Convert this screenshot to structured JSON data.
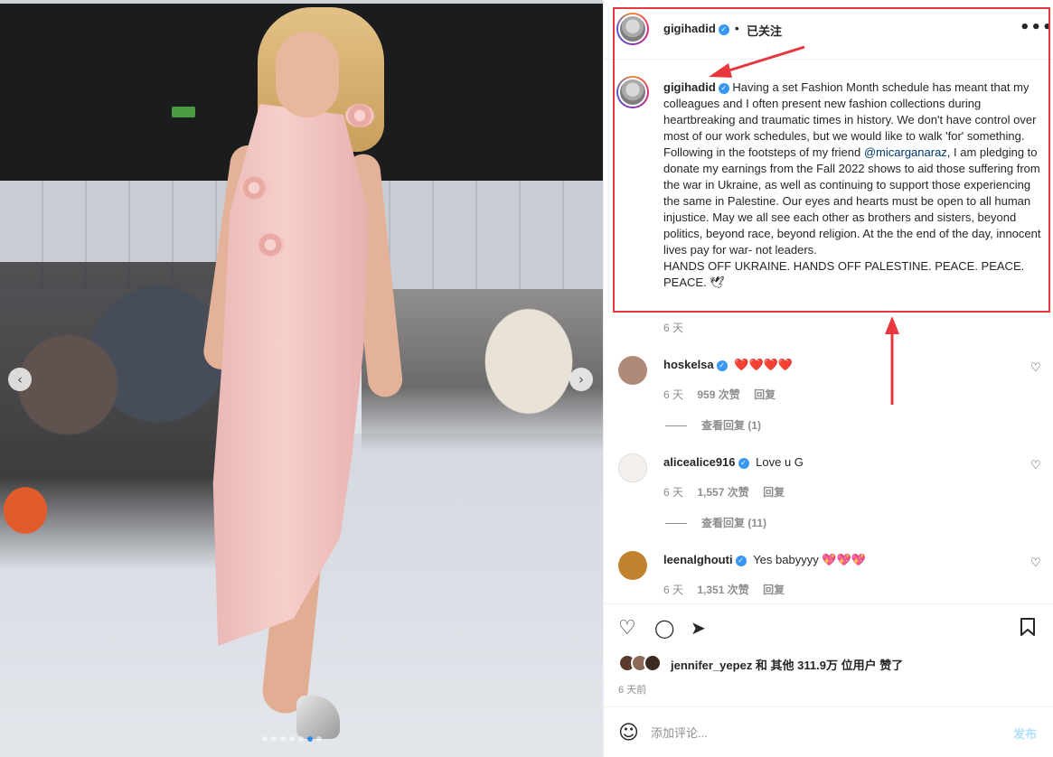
{
  "post": {
    "author": "gigihadid",
    "follow_status": "已关注",
    "dot": "•",
    "more": "•••",
    "caption_prefix": "Having a set Fashion Month schedule has meant that my colleagues and I often present new fashion collections during heartbreaking and traumatic times in history. We don't have control over most of our work schedules, but we would like to walk 'for' something. Following in the footsteps of my friend ",
    "caption_mention": "@micarganaraz",
    "caption_suffix": ", I am pledging to donate my earnings from the Fall 2022 shows to aid those suffering from the war in Ukraine, as well as continuing to support those experiencing the same in Palestine. Our eyes and hearts must be open to all human injustice. May we all see each other as brothers and sisters, beyond politics, beyond race, beyond religion. At the the end of the day, innocent lives pay for war- not leaders.",
    "caption_line2": "HANDS OFF UKRAINE. HANDS OFF PALESTINE. PEACE. PEACE. PEACE. 🕊",
    "caption_time": "6 天",
    "verified_glyph": "✓"
  },
  "comments": [
    {
      "user": "hoskelsa",
      "text": "❤️❤️❤️❤️",
      "time": "6 天",
      "likes": "959 次赞",
      "reply": "回复",
      "view_replies": "查看回复 (1)",
      "avatar_color": "#b08a78"
    },
    {
      "user": "alicealice916",
      "text": "Love u G",
      "time": "6 天",
      "likes": "1,557 次赞",
      "reply": "回复",
      "view_replies": "查看回复 (11)",
      "avatar_color": "#f4f0ee"
    },
    {
      "user": "leenalghouti",
      "text": "Yes babyyyy 💖💖💖",
      "time": "6 天",
      "likes": "1,351 次赞",
      "reply": "回复",
      "avatar_color": "#c1822e"
    }
  ],
  "likes_line": "jennifer_yepez 和 其他 311.9万 位用户 赞了",
  "post_time": "6 天前",
  "comment_input": {
    "placeholder": "添加评论..."
  },
  "post_button": "发布",
  "icons": {
    "heart": "♡",
    "comment": "◯",
    "share": "➤",
    "bookmark": "🔖",
    "smile": "☺",
    "prev": "‹",
    "next": "›"
  },
  "colors": {
    "highlight": "#e8383d",
    "verified": "#3897f0",
    "post_button": "#b2dffc"
  },
  "carousel": {
    "slide_count": 7,
    "active_slide": 5
  }
}
